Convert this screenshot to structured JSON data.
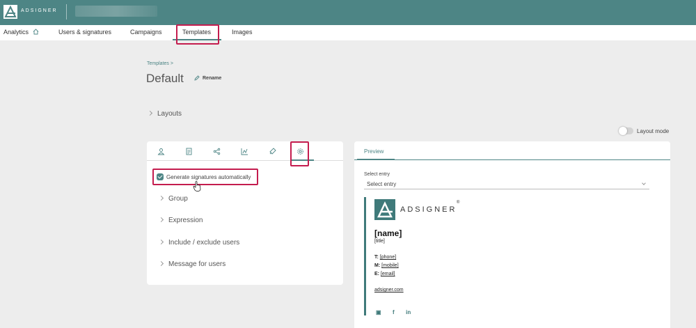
{
  "app": {
    "logo_text": "ADSIGNER"
  },
  "nav": {
    "items": [
      {
        "label": "Analytics"
      },
      {
        "label": "Users & signatures"
      },
      {
        "label": "Campaigns"
      },
      {
        "label": "Templates"
      },
      {
        "label": "Images"
      }
    ],
    "active": "Templates"
  },
  "breadcrumb": "Templates >",
  "page": {
    "title": "Default",
    "rename_label": "Rename",
    "layouts_label": "Layouts",
    "layout_mode_label": "Layout mode"
  },
  "settings_panel": {
    "tab_icons": [
      "user-icon",
      "document-icon",
      "share-icon",
      "chart-icon",
      "rocket-icon",
      "gear-icon"
    ],
    "active_tab": "gear-icon",
    "generate_label": "Generate signatures automatically",
    "generate_checked": true,
    "options": [
      {
        "label": "Group"
      },
      {
        "label": "Expression"
      },
      {
        "label": "Include / exclude users"
      },
      {
        "label": "Message for users"
      }
    ]
  },
  "preview_panel": {
    "tab_label": "Preview",
    "select_label": "Select entry",
    "select_value": "Select entry",
    "signature": {
      "logo_text": "ADSIGNER",
      "registered": "®",
      "name": "[name]",
      "title": "[title]",
      "phone_label": "T:",
      "phone": "[phone]",
      "mobile_label": "M:",
      "mobile": "[mobile]",
      "email_label": "E:",
      "email": "[email]",
      "website": "adsigner.com",
      "social_icons": [
        "image-icon",
        "facebook-icon",
        "linkedin-icon"
      ]
    }
  },
  "colors": {
    "brand": "#4d8585",
    "highlight": "#c41c4e",
    "background": "#ededed"
  }
}
